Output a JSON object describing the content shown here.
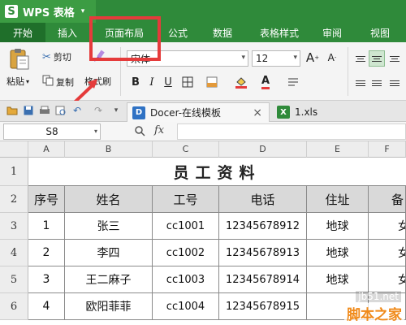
{
  "app": {
    "logo_glyph": "S",
    "title": "WPS 表格",
    "caret": "▾"
  },
  "tabs": [
    "开始",
    "插入",
    "页面布局",
    "公式",
    "数据",
    "表格样式",
    "审阅",
    "视图"
  ],
  "active_tab": 0,
  "ribbon": {
    "paste_label": "粘贴",
    "cut_label": "剪切",
    "copy_label": "复制",
    "format_painter_label": "格式刷",
    "font_name": "宋体",
    "font_size": "12",
    "grow_font": "A",
    "shrink_font": "A",
    "bold": "B",
    "italic": "I",
    "underline": "U",
    "font_color_glyph": "A",
    "accent_red": "#e53b3b"
  },
  "doc_tabs": [
    {
      "icon": "docer-icon",
      "label": "Docer-在线模板",
      "close": "×"
    },
    {
      "icon": "xls-icon",
      "label": "1.xls"
    }
  ],
  "formula_bar": {
    "cell_ref": "S8",
    "fx_label": "fx",
    "value": ""
  },
  "columns": [
    "A",
    "B",
    "C",
    "D",
    "E",
    "F"
  ],
  "rows": [
    "1",
    "2",
    "3",
    "4",
    "5",
    "6"
  ],
  "sheet": {
    "title": "员工资料",
    "headers": [
      "序号",
      "姓名",
      "工号",
      "电话",
      "住址",
      "备"
    ],
    "data": [
      [
        "1",
        "张三",
        "cc1001",
        "12345678912",
        "地球",
        "女"
      ],
      [
        "2",
        "李四",
        "cc1002",
        "12345678913",
        "地球",
        "女"
      ],
      [
        "3",
        "王二麻子",
        "cc1003",
        "12345678914",
        "地球",
        "女"
      ],
      [
        "4",
        "欧阳菲菲",
        "cc1004",
        "12345678915",
        "",
        ""
      ]
    ]
  },
  "watermark": {
    "site": "jb51.net",
    "brand": "脚本之家"
  }
}
